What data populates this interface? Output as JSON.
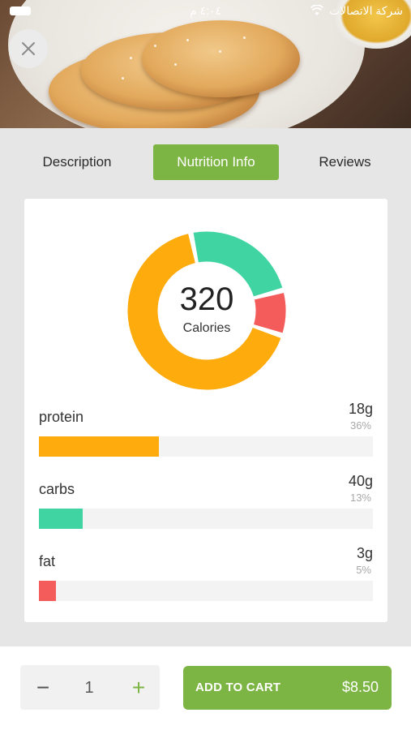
{
  "status_bar": {
    "time": "٤:٠٤ م",
    "carrier": "شركة الاتصالات"
  },
  "icons": {
    "close": "close-icon",
    "wifi": "wifi-icon",
    "battery": "battery-icon",
    "minus": "minus-icon",
    "plus": "plus-icon"
  },
  "tabs": [
    {
      "label": "Description",
      "active": false
    },
    {
      "label": "Nutrition Info",
      "active": true
    },
    {
      "label": "Reviews",
      "active": false
    }
  ],
  "nutrition": {
    "calories_value": "320",
    "calories_label": "Calories",
    "macros": [
      {
        "name": "protein",
        "amount": "18g",
        "percent": "36%",
        "percent_value": 36,
        "color": "#fdab0d"
      },
      {
        "name": "carbs",
        "amount": "40g",
        "percent": "13%",
        "percent_value": 13,
        "color": "#3fd4a2"
      },
      {
        "name": "fat",
        "amount": "3g",
        "percent": "5%",
        "percent_value": 5,
        "color": "#f45c5c"
      }
    ]
  },
  "colors": {
    "accent": "#7db545",
    "protein": "#fdab0d",
    "carbs": "#3fd4a2",
    "fat": "#f45c5c"
  },
  "cart": {
    "quantity": "1",
    "minus_symbol": "−",
    "plus_symbol": "+",
    "button_label": "ADD TO CART",
    "price": "$8.50"
  }
}
